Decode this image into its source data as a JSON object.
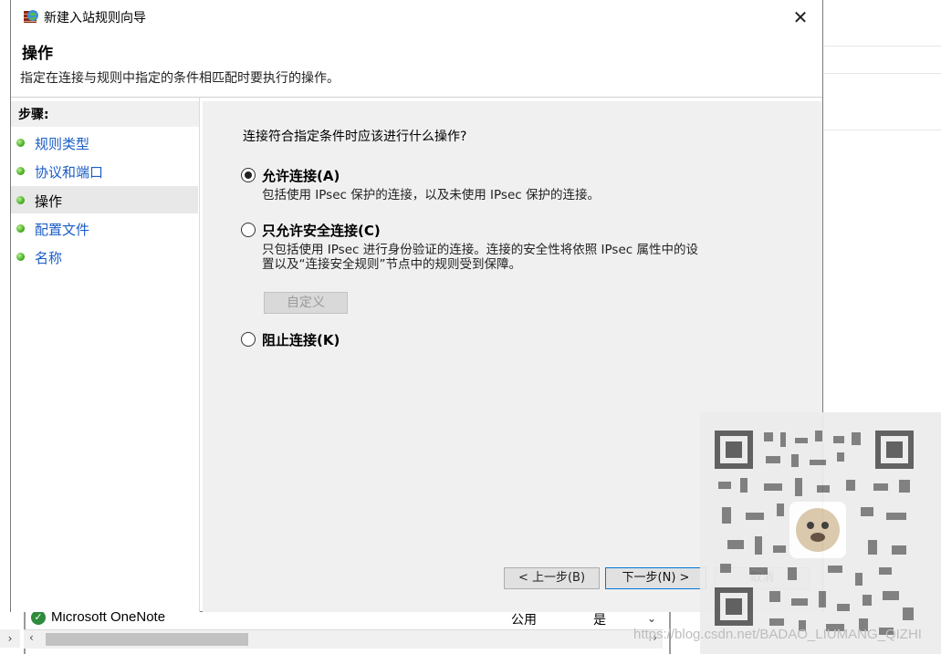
{
  "window": {
    "title": "新建入站规则向导",
    "close_icon": "close-icon"
  },
  "header": {
    "title": "操作",
    "description": "指定在连接与规则中指定的条件相匹配时要执行的操作。"
  },
  "steps": {
    "title": "步骤:",
    "items": [
      {
        "label": "规则类型",
        "active": false
      },
      {
        "label": "协议和端口",
        "active": false
      },
      {
        "label": "操作",
        "active": true
      },
      {
        "label": "配置文件",
        "active": false
      },
      {
        "label": "名称",
        "active": false
      }
    ]
  },
  "content": {
    "question": "连接符合指定条件时应该进行什么操作?",
    "options": [
      {
        "label": "允许连接(A)",
        "checked": true,
        "desc": [
          "包括使用 IPsec 保护的连接，以及未使用 IPsec 保护的连接。"
        ]
      },
      {
        "label": "只允许安全连接(C)",
        "checked": false,
        "desc": [
          "只包括使用 IPsec 进行身份验证的连接。连接的安全性将依照 IPsec 属性中的设",
          "置以及“连接安全规则”节点中的规则受到保障。"
        ]
      },
      {
        "label": "阻止连接(K)",
        "checked": false,
        "desc": []
      }
    ],
    "customize_label": "自定义"
  },
  "buttons": {
    "prev": "< 上一步(B)",
    "next": "下一步(N) >",
    "cancel": "取消"
  },
  "background": {
    "row": {
      "name": "Microsoft OneNote",
      "col1": "公用",
      "col2": "是"
    }
  },
  "watermark": "https://blog.csdn.net/BADAO_LIUMANG_QIZHI"
}
